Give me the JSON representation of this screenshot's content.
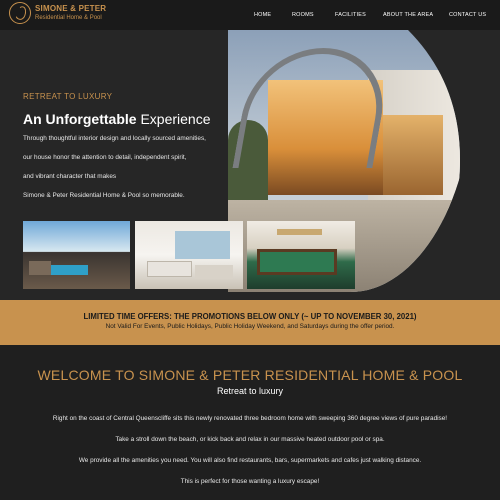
{
  "header": {
    "logo": {
      "line1": "SIMONE & PETER",
      "line2": "Residential Home & Pool"
    },
    "nav": [
      "HOME",
      "ROOMS",
      "FACILITIES",
      "ABOUT THE AREA",
      "CONTACT US"
    ]
  },
  "hero": {
    "eyebrow": "RETREAT TO LUXURY",
    "headline_bold": "An Unforgettable",
    "headline_rest": " Experience",
    "lines": [
      "Through thoughtful interior design and locally sourced amenities,",
      "our house honor the attention to detail, independent spirit,",
      "and vibrant character that makes",
      "Simone & Peter Residential Home & Pool so memorable."
    ]
  },
  "promo": {
    "title": "LIMITED TIME OFFERS: THE PROMOTIONS BELOW ONLY (~ UP TO NOVEMBER 30, 2021)",
    "subtitle": "Not Valid For Events, Public Holidays, Public Holiday Weekend, and Saturdays during the offer period."
  },
  "welcome": {
    "title": "WELCOME TO SIMONE & PETER RESIDENTIAL HOME & POOL",
    "subtitle": "Retreat to luxury",
    "paragraphs": [
      "Right on the coast of Central Queenscliffe sits this newly renovated three bedroom home with sweeping 360 degree views of pure paradise!",
      "Take a stroll down the beach, or kick back and relax in our massive heated outdoor pool or spa.",
      "We provide all the amenities you need. You will also find restaurants, bars, supermarkets and cafes just walking distance.",
      "This is perfect for those wanting a luxury escape!"
    ]
  },
  "colors": {
    "accent": "#c8924e",
    "background": "#1f1f1f",
    "header": "#1a1a1a"
  }
}
